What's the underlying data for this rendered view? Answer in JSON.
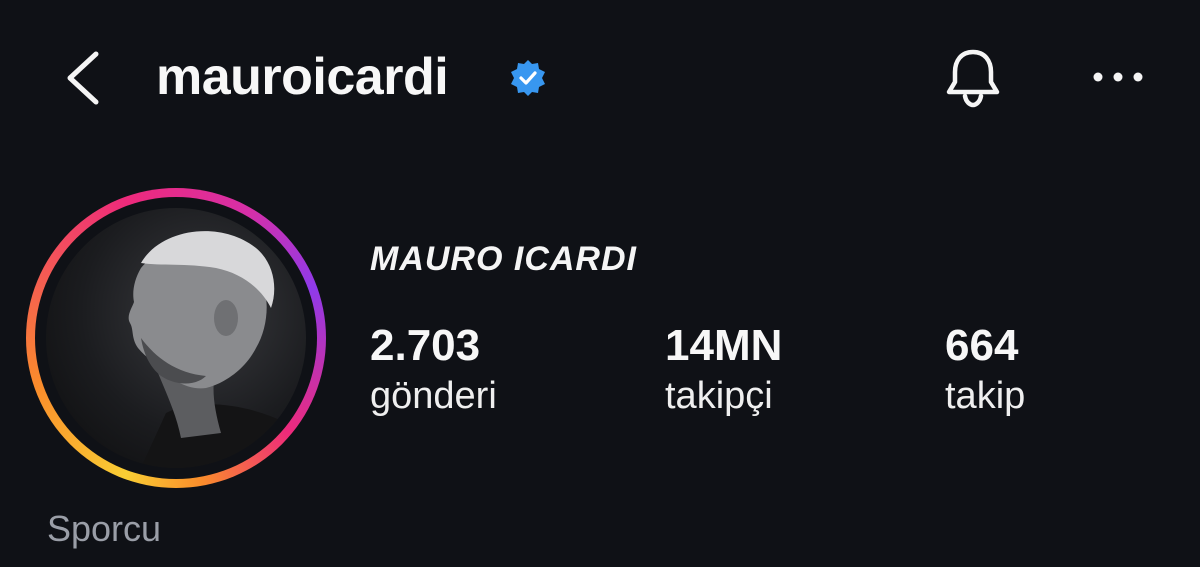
{
  "header": {
    "username": "mauroicardi",
    "back_icon": "chevron-left-icon",
    "verified_icon": "verified-badge-icon",
    "notification_icon": "bell-icon",
    "more_icon": "more-horizontal-icon"
  },
  "profile": {
    "full_name": "MAURO ICARDI",
    "category": "Sporcu",
    "stats": [
      {
        "value": "2.703",
        "label": "gönderi"
      },
      {
        "value": "14MN",
        "label": "takipçi"
      },
      {
        "value": "664",
        "label": "takip"
      }
    ]
  },
  "colors": {
    "background": "#0f1116",
    "verified_blue": "#3897f0",
    "ring_gradient": [
      "#f9ce34",
      "#ee2a7b",
      "#8f3aea"
    ]
  }
}
